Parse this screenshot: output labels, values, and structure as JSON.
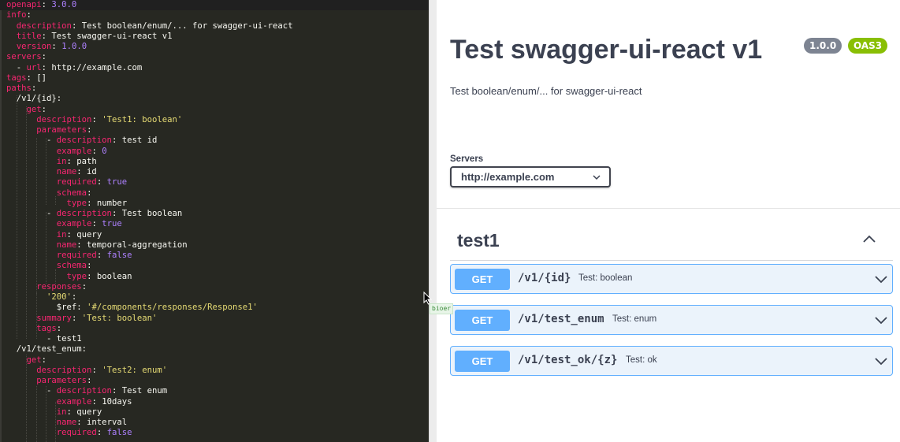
{
  "editor": {
    "lines": [
      [
        [
          "k",
          "openapi"
        ],
        [
          "p",
          ": "
        ],
        [
          "n",
          "3.0.0"
        ]
      ],
      [
        [
          "k",
          "info"
        ],
        [
          "p",
          ":"
        ]
      ],
      [
        [
          "p",
          "  "
        ],
        [
          "k",
          "description"
        ],
        [
          "p",
          ": Test boolean/enum/... for swagger-ui-react"
        ]
      ],
      [
        [
          "p",
          "  "
        ],
        [
          "k",
          "title"
        ],
        [
          "p",
          ": Test swagger-ui-react v1"
        ]
      ],
      [
        [
          "p",
          "  "
        ],
        [
          "k",
          "version"
        ],
        [
          "p",
          ": "
        ],
        [
          "n",
          "1.0.0"
        ]
      ],
      [
        [
          "k",
          "servers"
        ],
        [
          "p",
          ":"
        ]
      ],
      [
        [
          "p",
          "  - "
        ],
        [
          "k",
          "url"
        ],
        [
          "p",
          ": http://example.com"
        ]
      ],
      [
        [
          "k",
          "tags"
        ],
        [
          "p",
          ": []"
        ]
      ],
      [
        [
          "k",
          "paths"
        ],
        [
          "p",
          ":"
        ]
      ],
      [
        [
          "p",
          "  /v1/{id}:"
        ]
      ],
      [
        [
          "p",
          "    "
        ],
        [
          "k",
          "get"
        ],
        [
          "p",
          ":"
        ]
      ],
      [
        [
          "p",
          "      "
        ],
        [
          "k",
          "description"
        ],
        [
          "p",
          ": "
        ],
        [
          "s",
          "'Test1: boolean'"
        ]
      ],
      [
        [
          "p",
          "      "
        ],
        [
          "k",
          "parameters"
        ],
        [
          "p",
          ":"
        ]
      ],
      [
        [
          "p",
          "        - "
        ],
        [
          "k",
          "description"
        ],
        [
          "p",
          ": test id"
        ]
      ],
      [
        [
          "p",
          "          "
        ],
        [
          "k",
          "example"
        ],
        [
          "p",
          ": "
        ],
        [
          "n",
          "0"
        ]
      ],
      [
        [
          "p",
          "          "
        ],
        [
          "k",
          "in"
        ],
        [
          "p",
          ": path"
        ]
      ],
      [
        [
          "p",
          "          "
        ],
        [
          "k",
          "name"
        ],
        [
          "p",
          ": id"
        ]
      ],
      [
        [
          "p",
          "          "
        ],
        [
          "k",
          "required"
        ],
        [
          "p",
          ": "
        ],
        [
          "n",
          "true"
        ]
      ],
      [
        [
          "p",
          "          "
        ],
        [
          "k",
          "schema"
        ],
        [
          "p",
          ":"
        ]
      ],
      [
        [
          "p",
          "            "
        ],
        [
          "k",
          "type"
        ],
        [
          "p",
          ": number"
        ]
      ],
      [
        [
          "p",
          "        - "
        ],
        [
          "k",
          "description"
        ],
        [
          "p",
          ": Test boolean"
        ]
      ],
      [
        [
          "p",
          "          "
        ],
        [
          "k",
          "example"
        ],
        [
          "p",
          ": "
        ],
        [
          "n",
          "true"
        ]
      ],
      [
        [
          "p",
          "          "
        ],
        [
          "k",
          "in"
        ],
        [
          "p",
          ": query"
        ]
      ],
      [
        [
          "p",
          "          "
        ],
        [
          "k",
          "name"
        ],
        [
          "p",
          ": temporal-aggregation"
        ]
      ],
      [
        [
          "p",
          "          "
        ],
        [
          "k",
          "required"
        ],
        [
          "p",
          ": "
        ],
        [
          "n",
          "false"
        ]
      ],
      [
        [
          "p",
          "          "
        ],
        [
          "k",
          "schema"
        ],
        [
          "p",
          ":"
        ]
      ],
      [
        [
          "p",
          "            "
        ],
        [
          "k",
          "type"
        ],
        [
          "p",
          ": boolean"
        ]
      ],
      [
        [
          "p",
          "      "
        ],
        [
          "k",
          "responses"
        ],
        [
          "p",
          ":"
        ]
      ],
      [
        [
          "p",
          "        "
        ],
        [
          "s",
          "'200'"
        ],
        [
          "p",
          ":"
        ]
      ],
      [
        [
          "p",
          "          $ref: "
        ],
        [
          "s",
          "'#/components/responses/Response1'"
        ]
      ],
      [
        [
          "p",
          "      "
        ],
        [
          "k",
          "summary"
        ],
        [
          "p",
          ": "
        ],
        [
          "s",
          "'Test: boolean'"
        ]
      ],
      [
        [
          "p",
          "      "
        ],
        [
          "k",
          "tags"
        ],
        [
          "p",
          ":"
        ]
      ],
      [
        [
          "p",
          "        - test1"
        ]
      ],
      [
        [
          "p",
          "  /v1/test_enum:"
        ]
      ],
      [
        [
          "p",
          "    "
        ],
        [
          "k",
          "get"
        ],
        [
          "p",
          ":"
        ]
      ],
      [
        [
          "p",
          "      "
        ],
        [
          "k",
          "description"
        ],
        [
          "p",
          ": "
        ],
        [
          "s",
          "'Test2: enum'"
        ]
      ],
      [
        [
          "p",
          "      "
        ],
        [
          "k",
          "parameters"
        ],
        [
          "p",
          ":"
        ]
      ],
      [
        [
          "p",
          "        - "
        ],
        [
          "k",
          "description"
        ],
        [
          "p",
          ": Test enum"
        ]
      ],
      [
        [
          "p",
          "          "
        ],
        [
          "k",
          "example"
        ],
        [
          "p",
          ": 10days"
        ]
      ],
      [
        [
          "p",
          "          "
        ],
        [
          "k",
          "in"
        ],
        [
          "p",
          ": query"
        ]
      ],
      [
        [
          "p",
          "          "
        ],
        [
          "k",
          "name"
        ],
        [
          "p",
          ": interval"
        ]
      ],
      [
        [
          "p",
          "          "
        ],
        [
          "k",
          "required"
        ],
        [
          "p",
          ": "
        ],
        [
          "n",
          "false"
        ]
      ]
    ],
    "tooltip": "bioer"
  },
  "info": {
    "title": "Test swagger-ui-react v1",
    "version": "1.0.0",
    "oas": "OAS3",
    "description": "Test boolean/enum/... for swagger-ui-react"
  },
  "servers": {
    "label": "Servers",
    "selected": "http://example.com"
  },
  "tag": {
    "name": "test1",
    "operations": [
      {
        "method": "GET",
        "path": "/v1/{id}",
        "summary": "Test: boolean"
      },
      {
        "method": "GET",
        "path": "/v1/test_enum",
        "summary": "Test: enum"
      },
      {
        "method": "GET",
        "path": "/v1/test_ok/{z}",
        "summary": "Test: ok"
      }
    ]
  },
  "colors": {
    "get": "#61affe",
    "get_bg": "#ebf3fb",
    "oas": "#89bf04",
    "version": "#7d8492",
    "editor_bg": "#272822"
  }
}
